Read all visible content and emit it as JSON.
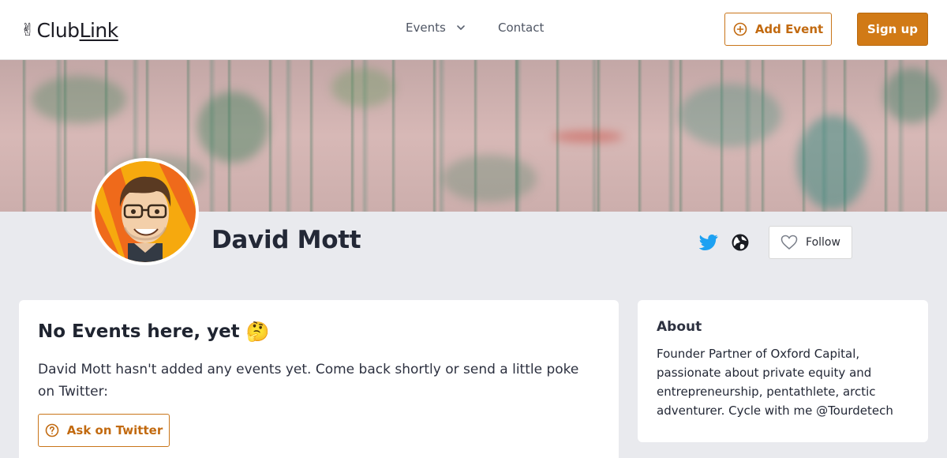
{
  "nav": {
    "logo": {
      "hand": "✌",
      "text_a": "Club",
      "text_b": "Link"
    },
    "events_label": "Events",
    "contact_label": "Contact",
    "add_event_label": "Add Event",
    "signup_label": "Sign up"
  },
  "profile": {
    "name": "David Mott",
    "follow_label": "Follow",
    "icons": [
      "twitter-icon",
      "globe-icon",
      "heart-icon"
    ]
  },
  "events": {
    "title": "No Events here, yet",
    "title_emoji": "🤔",
    "message": "David Mott hasn't added any events yet. Come back shortly or send a little poke on Twitter:",
    "ask_label": "Ask on Twitter"
  },
  "about": {
    "title": "About",
    "text": "Founder Partner of Oxford Capital, passionate about private equity and entrepreneurship, pentathlete, arctic adventurer. Cycle with me @Tourdetech"
  },
  "colors": {
    "accent": "#d17a16",
    "accent_text": "#c26a10",
    "twitter": "#1da1f2",
    "page_bg": "#e9eaee"
  }
}
